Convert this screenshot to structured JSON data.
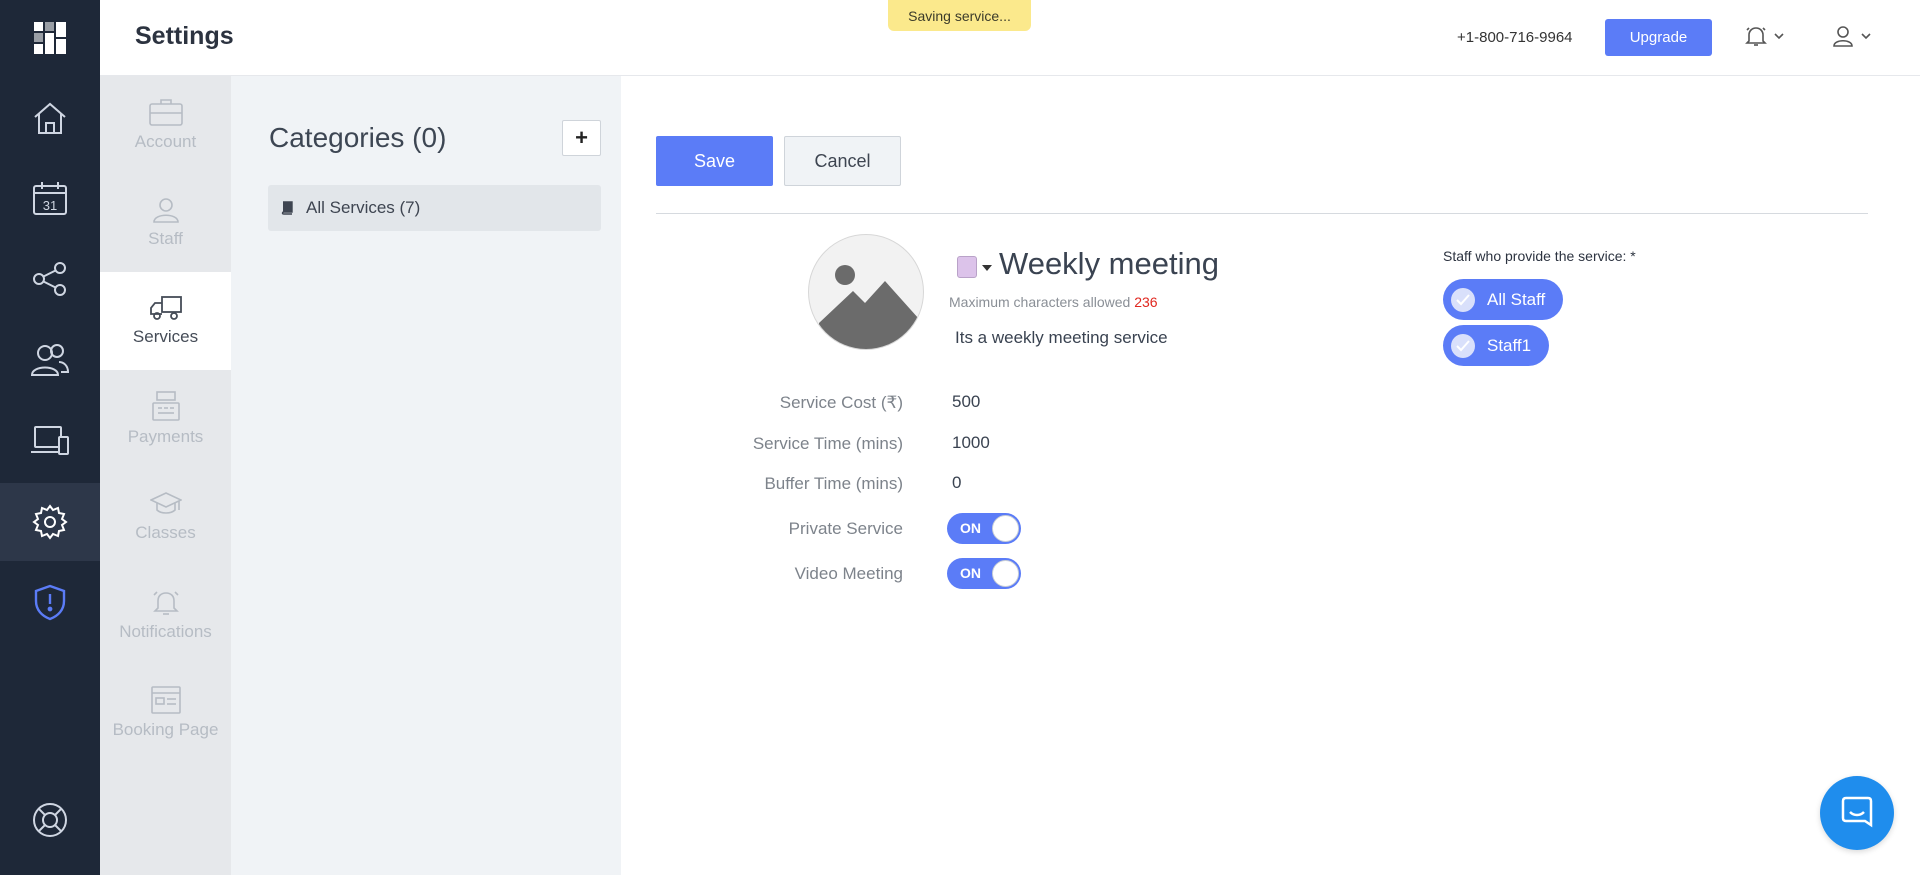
{
  "header": {
    "title": "Settings",
    "toast": "Saving service...",
    "phone": "+1-800-716-9964",
    "upgrade_label": "Upgrade"
  },
  "rail": {
    "items": [
      "home-icon",
      "calendar-icon",
      "share-icon",
      "users-icon",
      "devices-icon",
      "settings-icon",
      "shield-alert-icon",
      "help-lifebuoy-icon"
    ],
    "calendar_day": "31",
    "active": "settings-icon"
  },
  "subnav": {
    "items": [
      {
        "label": "Account",
        "icon": "briefcase-icon"
      },
      {
        "label": "Staff",
        "icon": "person-icon"
      },
      {
        "label": "Services",
        "icon": "truck-icon"
      },
      {
        "label": "Payments",
        "icon": "cash-register-icon"
      },
      {
        "label": "Classes",
        "icon": "graduation-cap-icon"
      },
      {
        "label": "Notifications",
        "icon": "bell-icon"
      },
      {
        "label": "Booking Page",
        "icon": "booking-page-icon"
      }
    ],
    "active": "Services"
  },
  "categories": {
    "title": "Categories (0)",
    "add_label": "+",
    "items": [
      {
        "label": "All Services (7)"
      }
    ]
  },
  "editor": {
    "save_label": "Save",
    "cancel_label": "Cancel",
    "service_name": "Weekly meeting",
    "color": "#dcc3ea",
    "max_chars_label": "Maximum characters allowed",
    "max_chars_value": "236",
    "description": "Its a weekly meeting service",
    "fields": [
      {
        "label": "Service Cost (₹)",
        "value": "500"
      },
      {
        "label": "Service Time (mins)",
        "value": "1000"
      },
      {
        "label": "Buffer Time (mins)",
        "value": "0"
      }
    ],
    "toggles": [
      {
        "label": "Private Service",
        "state": "ON"
      },
      {
        "label": "Video Meeting",
        "state": "ON"
      }
    ],
    "staff_title": "Staff who provide the service: *",
    "staff": [
      {
        "label": "All Staff"
      },
      {
        "label": "Staff1"
      }
    ]
  },
  "colors": {
    "accent": "#5b7cf7",
    "rail": "#1e2838",
    "toast": "#fbe98c",
    "required_count": "#e0271f",
    "chat": "#1f8ded"
  }
}
